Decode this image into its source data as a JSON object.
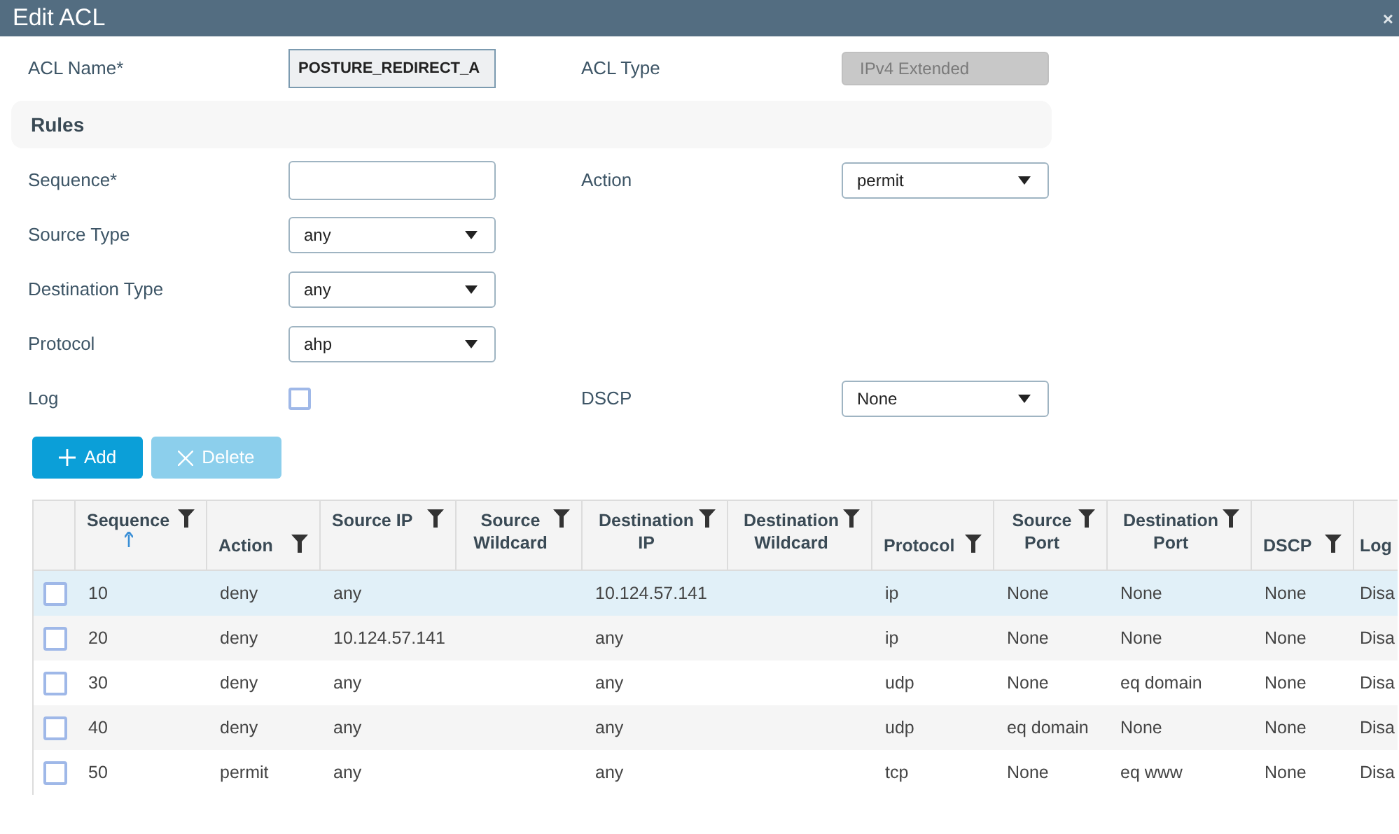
{
  "window": {
    "title": "Edit ACL",
    "close": "×"
  },
  "acl_name": {
    "label": "ACL Name*",
    "value": "POSTURE_REDIRECT_A"
  },
  "acl_type": {
    "label": "ACL Type",
    "value": "IPv4 Extended",
    "disabled": true
  },
  "section": "Rules",
  "form": [
    {
      "label": "Sequence*",
      "kind": "text",
      "right": {
        "label": "Action",
        "value": "permit"
      }
    },
    {
      "label": "Source Type",
      "kind": "select",
      "value": "any"
    },
    {
      "label": "Destination Type",
      "kind": "select",
      "value": "any"
    },
    {
      "label": "Protocol",
      "kind": "select",
      "value": "ahp"
    },
    {
      "label": "Log",
      "kind": "checkbox",
      "checked": false,
      "right": {
        "label": "DSCP",
        "value": "None"
      }
    }
  ],
  "buttons": [
    {
      "label": "Add",
      "kind": "add",
      "disabled": false
    },
    {
      "label": "Delete",
      "kind": "delete",
      "disabled": true
    }
  ],
  "table": {
    "columns": [
      {
        "label": "Sequence",
        "filter": true,
        "sorted": true
      },
      {
        "label": "Action",
        "filter": true,
        "sorted": false
      },
      {
        "label": "Source IP",
        "filter": true,
        "sorted": false
      },
      {
        "label": "Source Wildcard",
        "filter": true,
        "sorted": false
      },
      {
        "label": "Destination IP",
        "filter": true,
        "sorted": false
      },
      {
        "label": "Destination Wildcard",
        "filter": true,
        "sorted": false
      },
      {
        "label": "Protocol",
        "filter": true,
        "sorted": false
      },
      {
        "label": "Source Port",
        "filter": true,
        "sorted": false
      },
      {
        "label": "Destination Port",
        "filter": true,
        "sorted": false
      },
      {
        "label": "DSCP",
        "filter": true,
        "sorted": false
      },
      {
        "label": "Log",
        "filter": false,
        "sorted": false
      }
    ],
    "rows": [
      {
        "selected": true,
        "checked": false,
        "cells": [
          "10",
          "deny",
          "any",
          "",
          "10.124.57.141",
          "",
          "ip",
          "None",
          "None",
          "None",
          "Disa"
        ]
      },
      {
        "selected": false,
        "checked": false,
        "cells": [
          "20",
          "deny",
          "10.124.57.141",
          "",
          "any",
          "",
          "ip",
          "None",
          "None",
          "None",
          "Disa"
        ]
      },
      {
        "selected": false,
        "checked": false,
        "cells": [
          "30",
          "deny",
          "any",
          "",
          "any",
          "",
          "udp",
          "None",
          "eq domain",
          "None",
          "Disa"
        ]
      },
      {
        "selected": false,
        "checked": false,
        "cells": [
          "40",
          "deny",
          "any",
          "",
          "any",
          "",
          "udp",
          "eq domain",
          "None",
          "None",
          "Disa"
        ]
      },
      {
        "selected": false,
        "checked": false,
        "cells": [
          "50",
          "permit",
          "any",
          "",
          "any",
          "",
          "tcp",
          "None",
          "eq www",
          "None",
          "Disa"
        ]
      }
    ]
  }
}
